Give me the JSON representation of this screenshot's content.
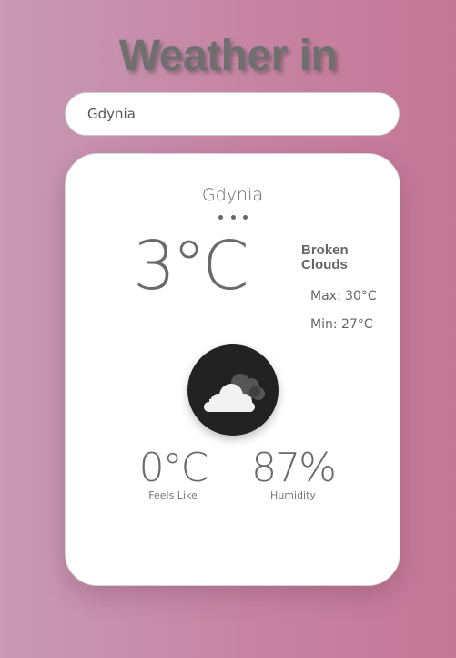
{
  "header": {
    "title": "Weather in"
  },
  "search": {
    "value": "Gdynia",
    "placeholder": ""
  },
  "weather": {
    "city": "Gdynia",
    "temperature": "3°C",
    "description": "Broken Clouds",
    "max": "Max: 30°C",
    "min": "Min: 27°C",
    "icon": "broken-clouds-icon",
    "feels_like_value": "0°C",
    "feels_like_label": "Feels Like",
    "humidity_value": "87%",
    "humidity_label": "Humidity"
  },
  "colors": {
    "background_start": "#c79ab5",
    "background_end": "#c47794",
    "card": "#ffffff",
    "icon_circle": "#222222",
    "text": "#666666"
  }
}
